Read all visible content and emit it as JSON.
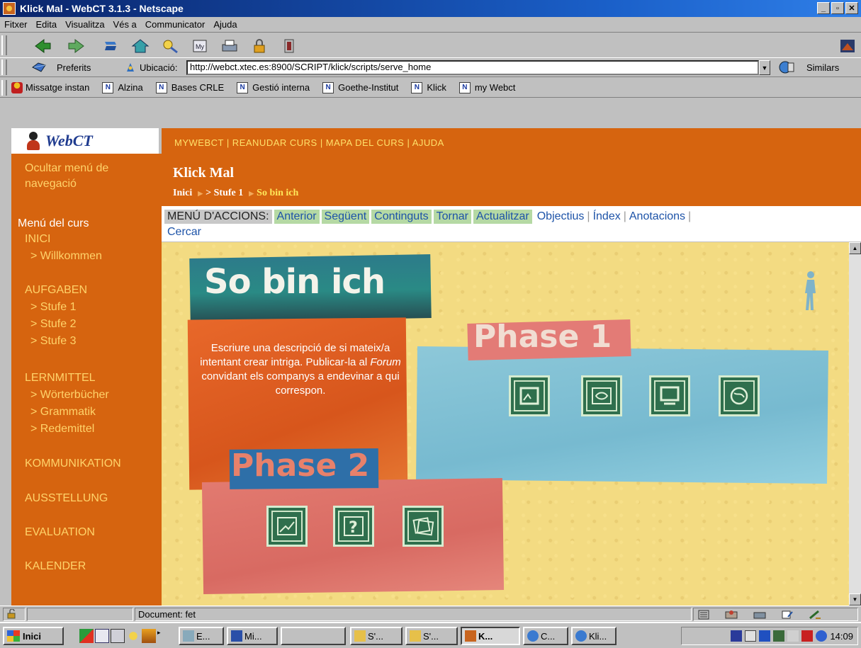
{
  "window": {
    "title": "Klick Mal - WebCT 3.1.3 - Netscape"
  },
  "menu": [
    "Fitxer",
    "Edita",
    "Visualitza",
    "Vés a",
    "Communicator",
    "Ajuda"
  ],
  "location": {
    "bookmarks_label": "Preferits",
    "url_label": "Ubicació:",
    "url": "http://webct.xtec.es:8900/SCRIPT/klick/scripts/serve_home",
    "related_label": "Similars"
  },
  "personal_toolbar": [
    "Missatge instan",
    "Alzina",
    "Bases CRLE",
    "Gestió interna",
    "Goethe-Institut",
    "Klick",
    "my Webct"
  ],
  "webct": {
    "logo_text": "WebCT",
    "top_links": "MYWEBCT  |  REANUDAR CURS  |  MAPA DEL CURS  |  AJUDA",
    "course_title": "Klick Mal",
    "breadcrumb": {
      "home": "Inici",
      "level1": "> Stufe 1",
      "current": "So bin ich"
    }
  },
  "left_nav": {
    "hide_label": "Ocultar menú de navegació",
    "course_menu": "Menú del curs",
    "items": [
      "INICI",
      "> Willkommen",
      "AUFGABEN",
      "> Stufe 1",
      "> Stufe 2",
      "> Stufe 3",
      "LERNMITTEL",
      "> Wörterbücher",
      "> Grammatik",
      "> Redemittel",
      "KOMMUNIKATION",
      "AUSSTELLUNG",
      "EVALUATION",
      "KALENDER"
    ]
  },
  "actions": {
    "label": "MENÚ D'ACCIONS:",
    "buttons": [
      "Anterior",
      "Següent",
      "Continguts",
      "Tornar",
      "Actualitzar"
    ],
    "links": [
      "Objectius",
      "Índex",
      "Anotacions",
      "Cercar"
    ]
  },
  "page": {
    "title": "So bin ich",
    "description_1": "Escriure una descripció de si mateix/a intentant crear intriga. Publicar-la al ",
    "description_forum": "Forum",
    "description_2": " convidant els companys a endevinar a qui correspon.",
    "phase1": "Phase 1",
    "phase2": "Phase 2"
  },
  "status": {
    "text": "Document: fet"
  },
  "taskbar": {
    "start": "Inici",
    "tasks": [
      "E...",
      "Mi...",
      "",
      "S'...",
      "S'...",
      "K...",
      "C...",
      "Kli..."
    ],
    "clock": "14:09"
  }
}
